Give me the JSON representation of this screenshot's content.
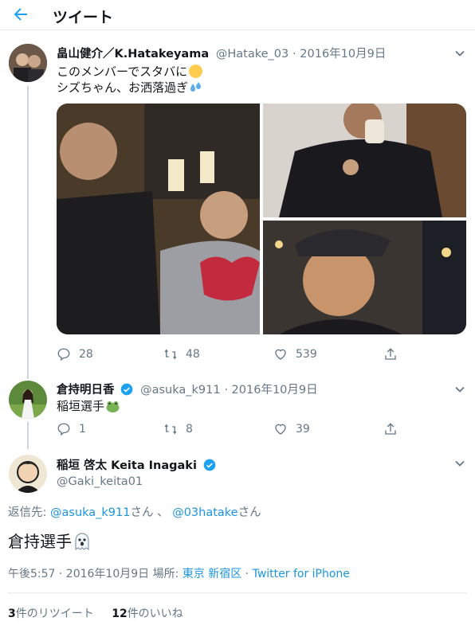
{
  "header": {
    "title": "ツイート"
  },
  "tweet1": {
    "name": "畠山健介／K.Hatakeyama",
    "handle": "@Hatake_03",
    "date": "2016年10月9日",
    "line1": "このメンバーでスタバに",
    "line2": "シズちゃん、お洒落過ぎ",
    "replies": "28",
    "retweets": "48",
    "likes": "539"
  },
  "tweet2": {
    "name": "倉持明日香",
    "handle": "@asuka_k911",
    "date": "2016年10月9日",
    "text": "稲垣選手",
    "replies": "1",
    "retweets": "8",
    "likes": "39"
  },
  "tweet3": {
    "name": "稲垣 啓太 Keita Inagaki",
    "handle": "@Gaki_keita01",
    "reply_prefix": "返信先: ",
    "reply_user1": "@asuka_k911",
    "reply_san1": "さん 、 ",
    "reply_user2": "@03hatake",
    "reply_san2": "さん",
    "text": "倉持選手",
    "time": "午後5:57 · 2016年10月9日 場所: ",
    "place": "東京 新宿区",
    "sep": " · ",
    "source": "Twitter for iPhone",
    "retweet_count": "3",
    "retweet_label": "件のリツイート",
    "like_count": "12",
    "like_label": "件のいいね"
  },
  "colors": {
    "accent": "#1da1f2",
    "link": "#1b95e0",
    "muted": "#657786"
  }
}
